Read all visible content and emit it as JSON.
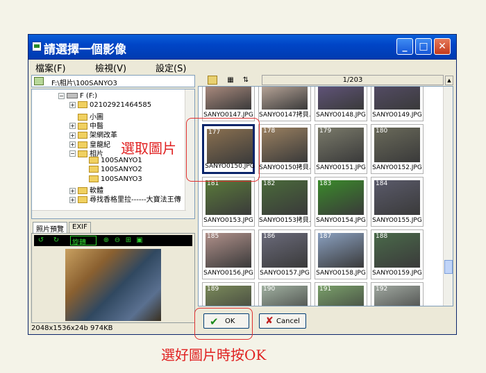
{
  "window": {
    "title": "請選擇一個影像",
    "minimize_glyph": "_",
    "maximize_glyph": "□",
    "close_glyph": "✕"
  },
  "menu": [
    "檔案(F)",
    "檢視(V)",
    "設定(S)"
  ],
  "path": "F:\\相片\\100SANYO3",
  "tree": [
    {
      "label": "F (F:)",
      "indent": 0,
      "type": "drive",
      "expander": "−"
    },
    {
      "label": "02102921464585",
      "indent": 1,
      "type": "folder",
      "expander": "+"
    },
    {
      "label": "小圖",
      "indent": 1,
      "type": "folder",
      "expander": ""
    },
    {
      "label": "中醫",
      "indent": 1,
      "type": "folder",
      "expander": "+"
    },
    {
      "label": "架網改革",
      "indent": 1,
      "type": "folder",
      "expander": "+"
    },
    {
      "label": "皇龍紀",
      "indent": 1,
      "type": "folder",
      "expander": "+"
    },
    {
      "label": "相片",
      "indent": 1,
      "type": "folder",
      "expander": "−"
    },
    {
      "label": "100SANYO1",
      "indent": 2,
      "type": "folder",
      "expander": ""
    },
    {
      "label": "100SANYO2",
      "indent": 2,
      "type": "folder",
      "expander": ""
    },
    {
      "label": "100SANYO3",
      "indent": 2,
      "type": "folder",
      "expander": ""
    },
    {
      "label": "軟體",
      "indent": 1,
      "type": "folder",
      "expander": "+"
    },
    {
      "label": "尋找香格里拉------大寶法王傳",
      "indent": 1,
      "type": "folder",
      "expander": "+"
    }
  ],
  "tabs": [
    "照片預覽",
    "EXIF"
  ],
  "preview_toolbar": {
    "rotate_label": "旋轉",
    "buttons": [
      "rotate-left-icon",
      "rotate-right-icon",
      "zoom-in-icon",
      "zoom-out-icon",
      "fit-icon",
      "actual-size-icon"
    ]
  },
  "status": "2048x1536x24b  974KB",
  "page_counter": "1/203",
  "thumbnails": [
    {
      "num": "",
      "label": "SANYO0147.JPG",
      "color": "#c9a090"
    },
    {
      "num": "",
      "label": "SANYO0147拷貝...",
      "color": "#d8c0b0"
    },
    {
      "num": "",
      "label": "SANYO0148.JPG",
      "color": "#6a5a8a"
    },
    {
      "num": "",
      "label": "SANYO0149.JPG",
      "color": "#5a5070"
    },
    {
      "num": "177",
      "label": "SANYO0150.JPG",
      "color": "#8a7050",
      "selected": true
    },
    {
      "num": "178",
      "label": "SANYO0150拷貝...",
      "color": "#9a8060"
    },
    {
      "num": "179",
      "label": "SANYO0151.JPG",
      "color": "#7a7a6a"
    },
    {
      "num": "180",
      "label": "SANYO0152.JPG",
      "color": "#6a6a5a"
    },
    {
      "num": "181",
      "label": "SANYO0153.JPG",
      "color": "#5a7a3a"
    },
    {
      "num": "182",
      "label": "SANYO0153拷貝...",
      "color": "#4a6a3a"
    },
    {
      "num": "183",
      "label": "SANYO0154.JPG",
      "color": "#3a8a2a"
    },
    {
      "num": "184",
      "label": "SANYO0155.JPG",
      "color": "#5a5a6a"
    },
    {
      "num": "185",
      "label": "SANYO0156.JPG",
      "color": "#b0908a"
    },
    {
      "num": "186",
      "label": "SANYO0157.JPG",
      "color": "#6a6a7a"
    },
    {
      "num": "187",
      "label": "SANYO0158.JPG",
      "color": "#8aa0c0"
    },
    {
      "num": "188",
      "label": "SANYO0159.JPG",
      "color": "#4a6a4a"
    },
    {
      "num": "189",
      "label": "",
      "color": "#7a8a5a"
    },
    {
      "num": "190",
      "label": "",
      "color": "#a0b0a0"
    },
    {
      "num": "191",
      "label": "",
      "color": "#7aa06a"
    },
    {
      "num": "192",
      "label": "",
      "color": "#a0a8a0"
    }
  ],
  "buttons": {
    "ok": "OK",
    "cancel": "Cancel"
  },
  "annotations": {
    "select_label": "選取圖片",
    "ok_hint": "選好圖片時按OK",
    "color": "#e02020"
  }
}
